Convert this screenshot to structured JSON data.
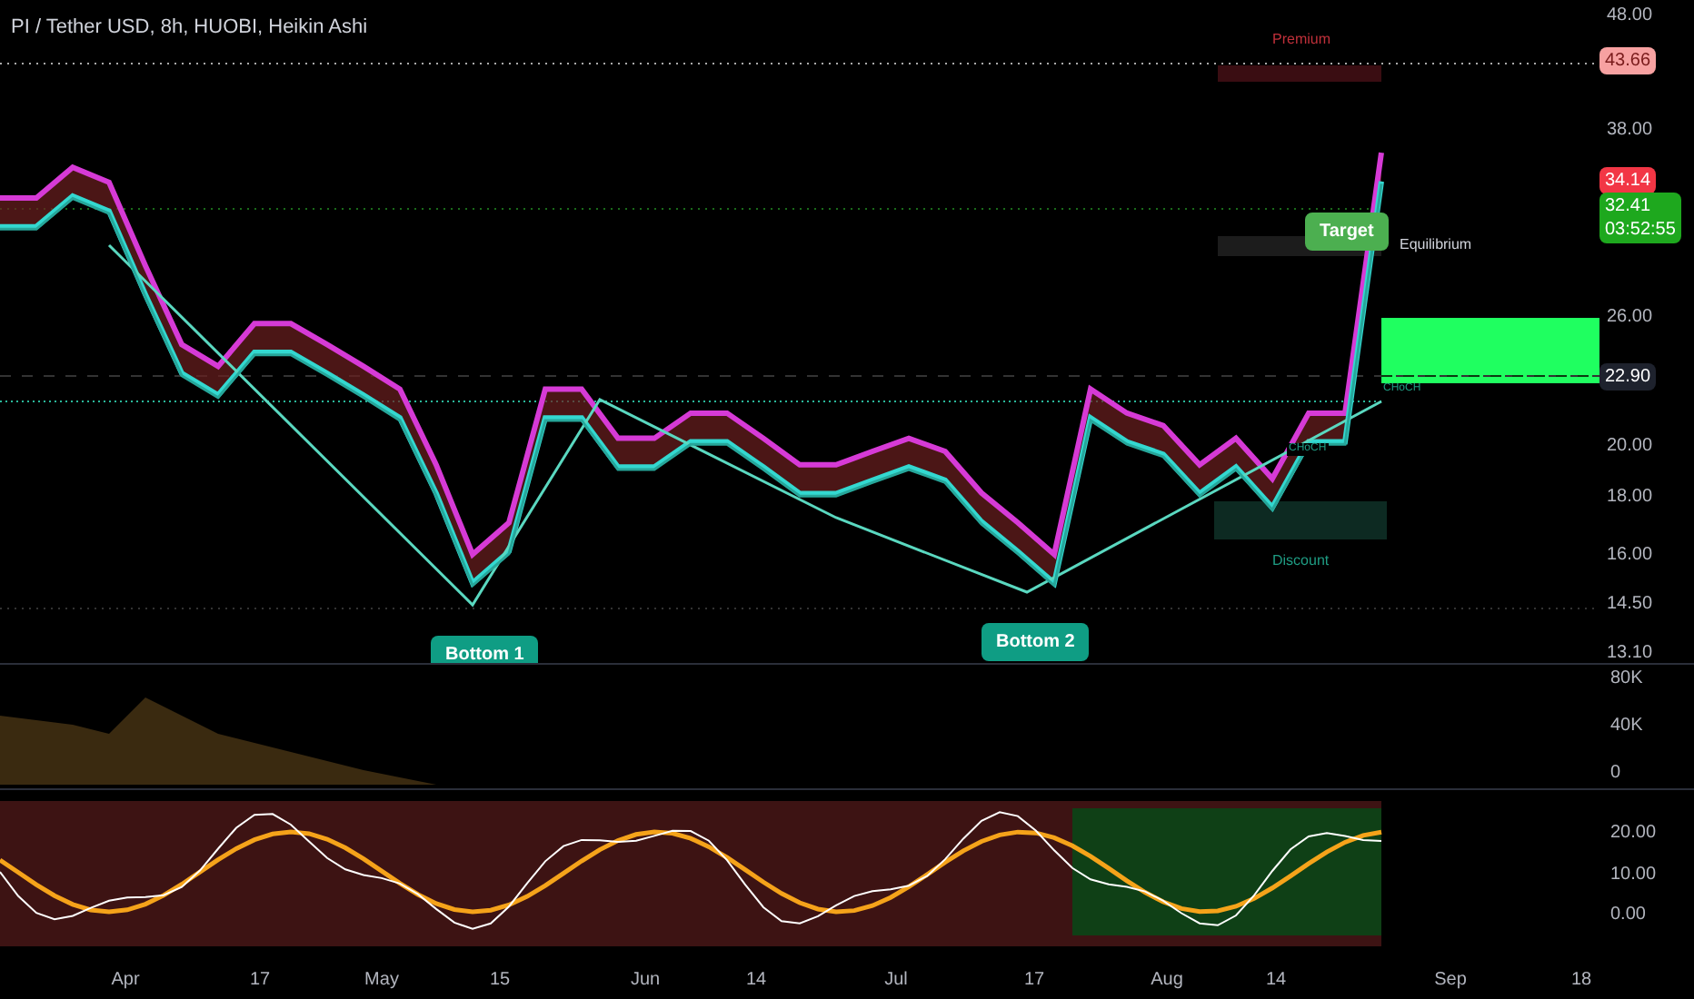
{
  "title": "PI / Tether USD, 8h, HUOBI, Heikin Ashi",
  "price_axis": [
    "48.00",
    "38.00",
    "26.00",
    "20.00",
    "18.00",
    "16.00",
    "14.50",
    "13.10"
  ],
  "time_axis": [
    "Apr",
    "17",
    "May",
    "15",
    "Jun",
    "14",
    "Jul",
    "17",
    "Aug",
    "14",
    "Sep",
    "18"
  ],
  "annotations": [
    {
      "text": "Premium",
      "kind": "zone"
    },
    {
      "text": "Target",
      "kind": "tag"
    },
    {
      "text": "Equilibrium",
      "kind": "zone"
    },
    {
      "text": "CHoCH",
      "kind": "marker"
    },
    {
      "text": "CHoCH",
      "kind": "marker"
    },
    {
      "text": "Discount",
      "kind": "zone"
    },
    {
      "text": "Bottom 1",
      "kind": "tag"
    },
    {
      "text": "Bottom 2",
      "kind": "tag"
    }
  ],
  "price_labels": [
    {
      "text": "43.66",
      "color": "#f7a1a1"
    },
    {
      "text": "34.14",
      "color": "#f23645"
    },
    {
      "text": "32.41",
      "countdown": "03:52:55",
      "color": "#1ea81e"
    },
    {
      "text": "22.90",
      "color": "#1e222d"
    }
  ],
  "volume_pane": {
    "axis_labels": [
      "80K",
      "40K",
      "0"
    ]
  },
  "oscillator_pane": {
    "axis_labels": [
      "20.00",
      "10.00",
      "0.00"
    ]
  }
}
